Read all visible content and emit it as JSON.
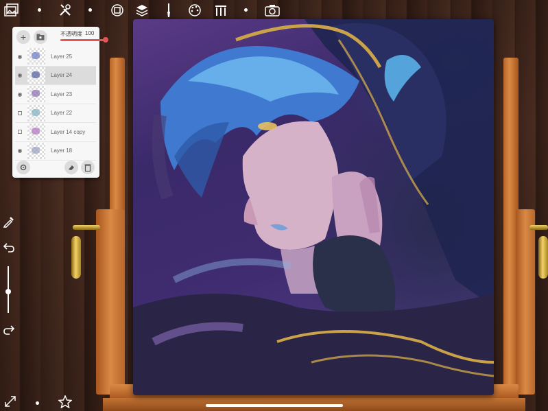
{
  "toolbar": {
    "icons": [
      "gallery-icon",
      "tools-icon",
      "layer-stack-icon",
      "layers-icon",
      "brush-icon",
      "palette-icon",
      "easel-icon",
      "camera-icon"
    ]
  },
  "layers_panel": {
    "opacity_label": "不透明度",
    "opacity_value": "100",
    "opacity": 1.0,
    "layers": [
      {
        "name": "Layer 25",
        "visible": true,
        "selected": false,
        "thumb_color": "#6a78c8"
      },
      {
        "name": "Layer 24",
        "visible": true,
        "selected": true,
        "thumb_color": "#4a5aa0"
      },
      {
        "name": "Layer 23",
        "visible": true,
        "selected": false,
        "thumb_color": "#8a6ab0"
      },
      {
        "name": "Layer 22",
        "visible": false,
        "selected": false,
        "thumb_color": "#7ab0c0"
      },
      {
        "name": "Layer 14 copy",
        "visible": false,
        "selected": false,
        "thumb_color": "#b070c0"
      },
      {
        "name": "Layer 18",
        "visible": true,
        "selected": false,
        "thumb_color": "#9aa0c0"
      }
    ]
  },
  "left_rail": {
    "icons": [
      "eyedropper-icon",
      "undo-icon",
      "brush-size-slider",
      "redo-icon"
    ],
    "brush_size": 0.45
  },
  "colors": {
    "accent": "#e45555",
    "panel_bg": "#f7f7f7"
  }
}
